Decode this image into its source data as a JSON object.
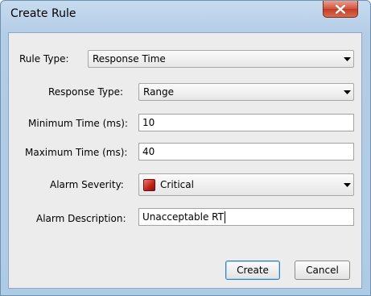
{
  "window": {
    "title": "Create Rule"
  },
  "form": {
    "rule_type": {
      "label": "Rule Type:",
      "value": "Response Time"
    },
    "response_type": {
      "label": "Response Type:",
      "value": "Range"
    },
    "min_time": {
      "label": "Minimum Time (ms):",
      "value": "10"
    },
    "max_time": {
      "label": "Maximum Time (ms):",
      "value": "40"
    },
    "alarm_severity": {
      "label": "Alarm Severity:",
      "value": "Critical",
      "color": "#c0211a",
      "icon": "severity-critical-icon"
    },
    "alarm_description": {
      "label": "Alarm Description:",
      "value": "Unacceptable RT"
    }
  },
  "buttons": {
    "create": "Create",
    "cancel": "Cancel"
  }
}
